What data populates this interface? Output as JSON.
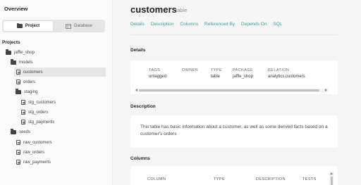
{
  "sidebar": {
    "overview_title": "Overview",
    "toggle": {
      "project_label": "Project",
      "database_label": "Database"
    },
    "projects_label": "Projects",
    "tree": [
      {
        "label": "jaffle_shop",
        "kind": "folder"
      },
      {
        "label": "models",
        "kind": "folder"
      },
      {
        "label": "customers",
        "kind": "file"
      },
      {
        "label": "orders",
        "kind": "file"
      },
      {
        "label": "staging",
        "kind": "folder"
      },
      {
        "label": "stg_customers",
        "kind": "file"
      },
      {
        "label": "stg_orders",
        "kind": "file"
      },
      {
        "label": "stg_payments",
        "kind": "file"
      },
      {
        "label": "seeds",
        "kind": "folder"
      },
      {
        "label": "raw_customers",
        "kind": "file"
      },
      {
        "label": "raw_orders",
        "kind": "file"
      },
      {
        "label": "raw_payments",
        "kind": "file"
      }
    ]
  },
  "main": {
    "title": "customers",
    "subtitle": "table",
    "tabs": [
      "Details",
      "Description",
      "Columns",
      "Referenced By",
      "Depends On",
      "SQL"
    ],
    "details": {
      "section_title": "Details",
      "columns": [
        {
          "header": "TAGS",
          "value": "untagged"
        },
        {
          "header": "OWNER",
          "value": ""
        },
        {
          "header": "TYPE",
          "value": "table"
        },
        {
          "header": "PACKAGE",
          "value": "jaffle_shop"
        },
        {
          "header": "RELATION",
          "value": "analytics.customers"
        }
      ]
    },
    "description": {
      "section_title": "Description",
      "text": "This table has basic information about a customer, as well as some derived facts based on a customer's orders"
    },
    "columns_section": {
      "section_title": "Columns",
      "headers": [
        "COLUMN",
        "TYPE",
        "DESCRIPTION",
        "TESTS"
      ]
    }
  },
  "colors": {
    "accent": "#3aa39a",
    "selected_bg": "#e6e6e6"
  }
}
